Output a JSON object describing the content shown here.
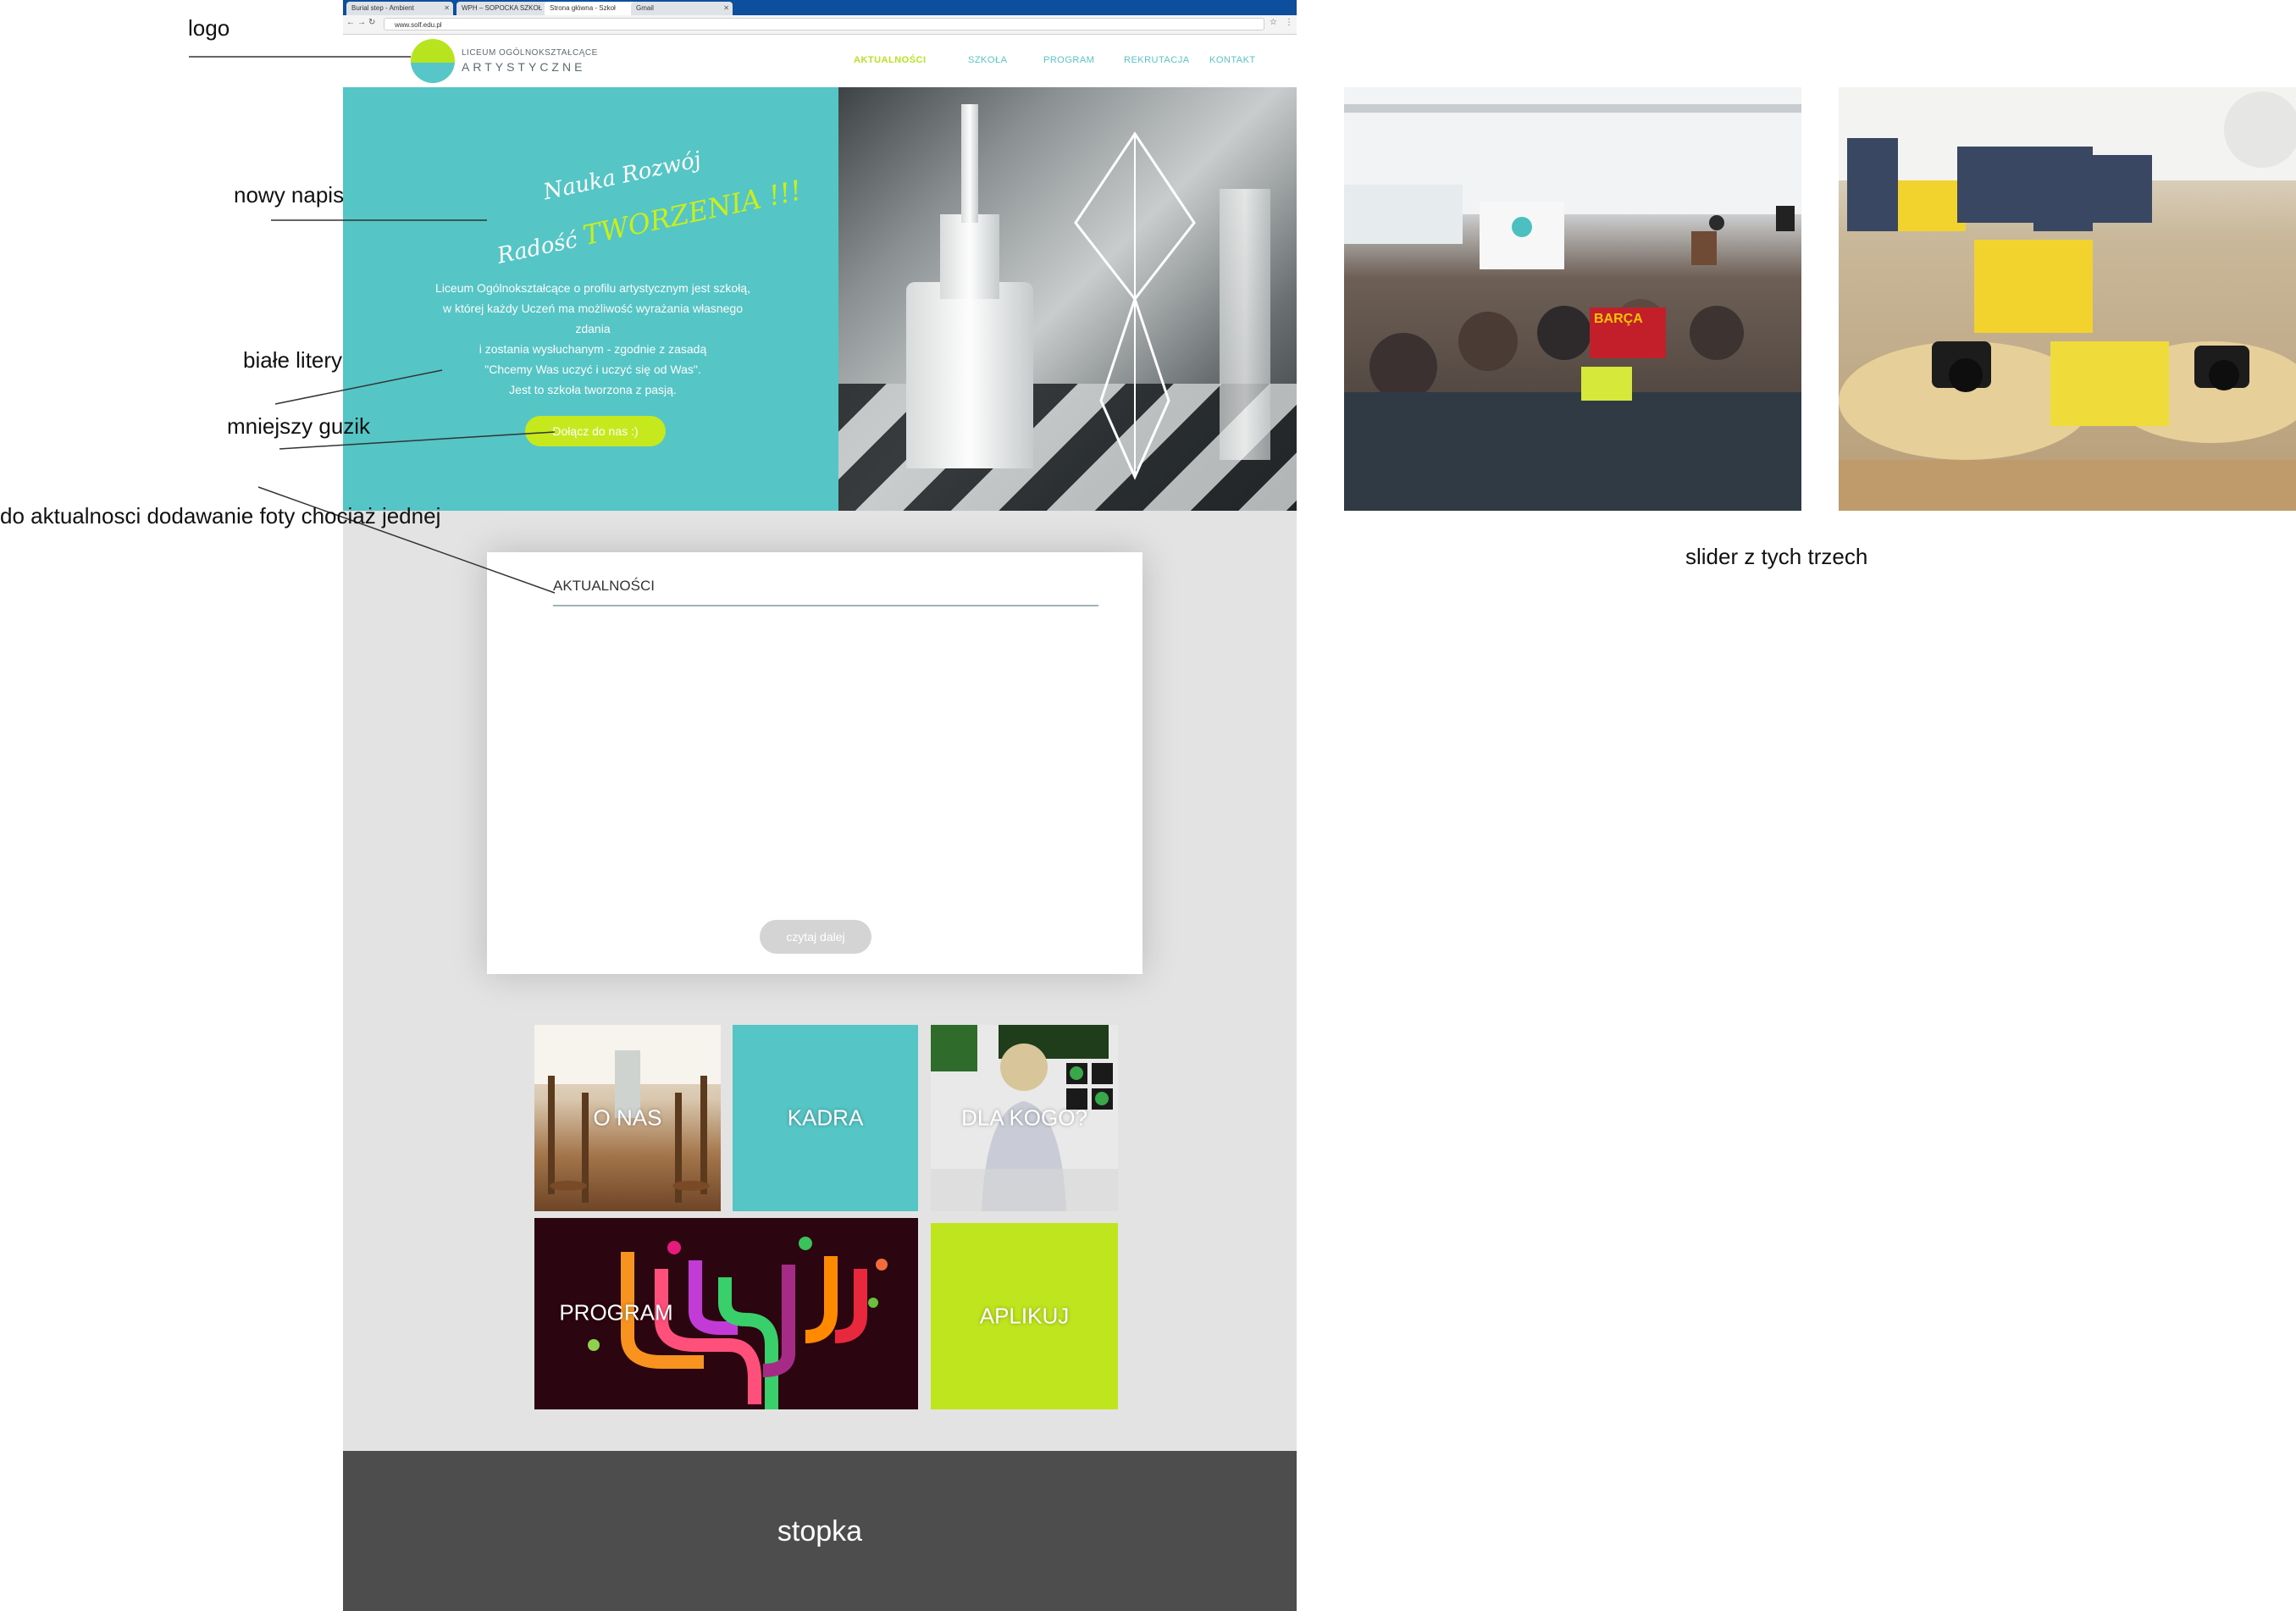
{
  "browser": {
    "tabs": [
      {
        "label": "Burial step - Ambient"
      },
      {
        "label": "WPH – SOPOCKA SZKOŁ"
      },
      {
        "label": "Strona główna - Szkoł"
      },
      {
        "label": "Gmail"
      }
    ],
    "url": "www.solf.edu.pl"
  },
  "header": {
    "logo_line1": "LICEUM OGÓLNOKSZTAŁCĄCE",
    "logo_line2": "ARTYSTYCZNE",
    "menu": [
      "AKTUALNOŚCI",
      "SZKOŁA",
      "PROGRAM",
      "REKRUTACJA",
      "KONTAKT"
    ]
  },
  "hero": {
    "tagline_line1": "Nauka Rozwój",
    "tagline_line2_prefix": "Radość",
    "tagline_line2_highlight": "TWORZENIA !!!",
    "description": "Liceum Ogólnokształcące o profilu artystycznym jest szkołą,\nw której każdy Uczeń ma możliwość wyrażania własnego zdania\ni zostania wysłuchanym - zgodnie z zasadą\n\"Chcemy Was uczyć i uczyć się od Was\".\nJest to szkoła tworzona z pasją.",
    "cta_label": "Dołącz do nas :)"
  },
  "news": {
    "title": "AKTUALNOŚCI",
    "read_more_label": "czytaj dalej"
  },
  "tiles": {
    "onas": "O NAS",
    "kadra": "KADRA",
    "dlakogo": "DLA KOGO?",
    "program": "PROGRAM",
    "aplikuj": "APLIKUJ"
  },
  "footer": {
    "label": "stopka"
  },
  "photo_text": {
    "jersey": "BARÇA"
  },
  "annotations": {
    "logo": "logo",
    "new_caption": "nowy napis",
    "white_letters": "białe litery",
    "smaller_button": "mniejszy guzik",
    "news_photo": "do aktualnosci dodawanie foty chociaż jednej",
    "slider": "slider z tych trzech"
  },
  "colors": {
    "teal": "#55c5c6",
    "lime": "#c6e91d",
    "content_bg": "#e3e3e3",
    "footer_bg": "#4d4d4d"
  }
}
